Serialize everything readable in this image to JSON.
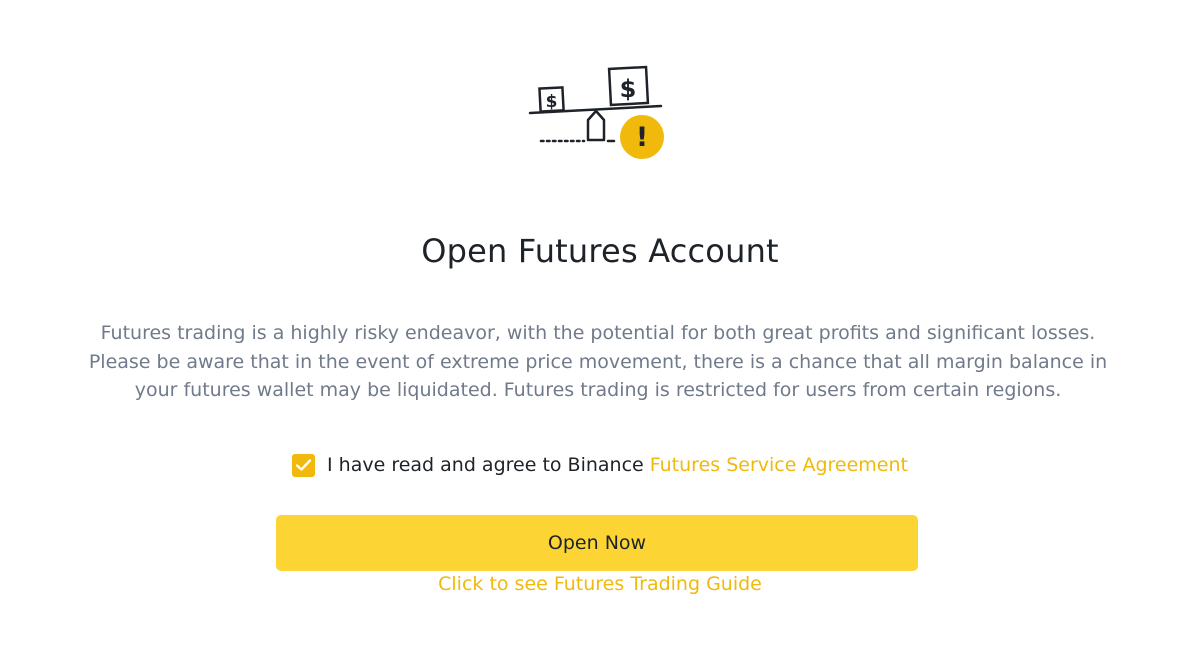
{
  "colors": {
    "accent": "#f0b90b",
    "button_bg": "#fcd535",
    "title_text": "#1e2329",
    "secondary_text": "#707a8a"
  },
  "illustration": {
    "icon": "scale-dollar-warning-icon",
    "left_box_symbol": "$",
    "right_box_symbol": "$",
    "warning_symbol": "!"
  },
  "header": {
    "title": "Open Futures Account"
  },
  "main": {
    "risk_disclaimer": "Futures trading is a highly risky endeavor, with the potential for both great profits and significant losses. Please be aware that in the event of extreme price movement, there is a chance that all margin balance in your futures wallet may be liquidated. Futures trading is restricted for users from certain regions."
  },
  "agreement": {
    "checked": true,
    "label": "I have read and agree to Binance",
    "link_text": "Futures Service Agreement"
  },
  "actions": {
    "open_button_label": "Open Now",
    "guide_link_text": "Click to see Futures Trading Guide"
  }
}
